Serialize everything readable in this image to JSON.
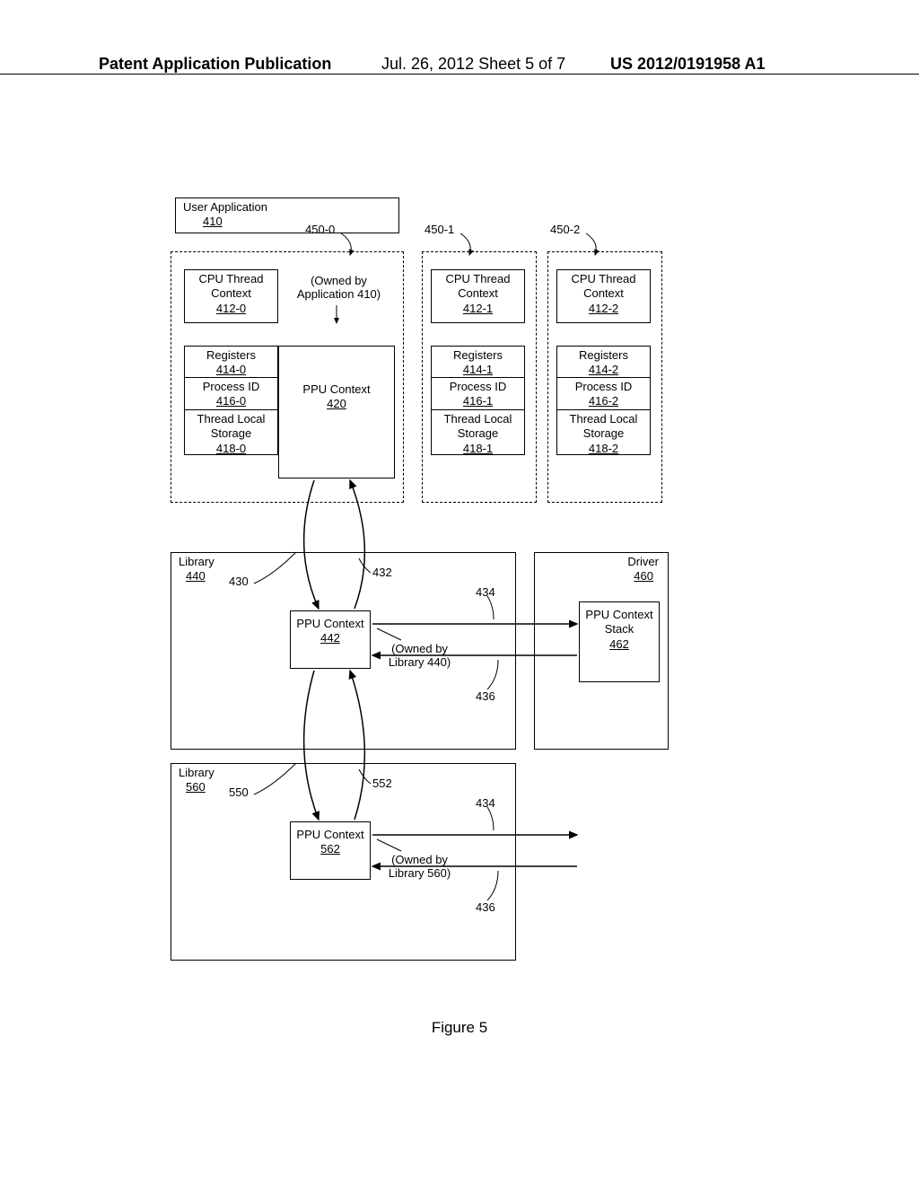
{
  "header": {
    "left": "Patent Application Publication",
    "mid": "Jul. 26, 2012   Sheet 5 of 7",
    "right": "US 2012/0191958 A1"
  },
  "app": {
    "title": "User Application",
    "num": "410"
  },
  "refs": {
    "r0": "450-0",
    "r1": "450-1",
    "r2": "450-2"
  },
  "ctx0": {
    "t": "CPU Thread Context",
    "n": "412-0"
  },
  "ctx1": {
    "t": "CPU Thread Context",
    "n": "412-1"
  },
  "ctx2": {
    "t": "CPU Thread Context",
    "n": "412-2"
  },
  "own410": "(Owned by Application 410)",
  "reg0": {
    "t": "Registers",
    "n": "414-0"
  },
  "reg1": {
    "t": "Registers",
    "n": "414-1"
  },
  "reg2": {
    "t": "Registers",
    "n": "414-2"
  },
  "pid0": {
    "t": "Process ID",
    "n": "416-0"
  },
  "pid1": {
    "t": "Process ID",
    "n": "416-1"
  },
  "pid2": {
    "t": "Process ID",
    "n": "416-2"
  },
  "tls0": {
    "t": "Thread Local Storage",
    "n": "418-0"
  },
  "tls1": {
    "t": "Thread Local Storage",
    "n": "418-1"
  },
  "tls2": {
    "t": "Thread Local Storage",
    "n": "418-2"
  },
  "ppu420": {
    "t": "PPU Context",
    "n": "420"
  },
  "lib440": {
    "t": "Library",
    "n": "440"
  },
  "ppu442": {
    "t": "PPU Context",
    "n": "442"
  },
  "own440": "(Owned by Library 440)",
  "lib560": {
    "t": "Library",
    "n": "560"
  },
  "ppu562": {
    "t": "PPU Context",
    "n": "562"
  },
  "own560": "(Owned by Library 560)",
  "driver": {
    "t": "Driver",
    "n": "460"
  },
  "stack": {
    "t": "PPU Context Stack",
    "n": "462"
  },
  "nums": {
    "n430": "430",
    "n432": "432",
    "n434a": "434",
    "n436a": "436",
    "n550": "550",
    "n552": "552",
    "n434b": "434",
    "n436b": "436"
  },
  "caption": "Figure 5"
}
